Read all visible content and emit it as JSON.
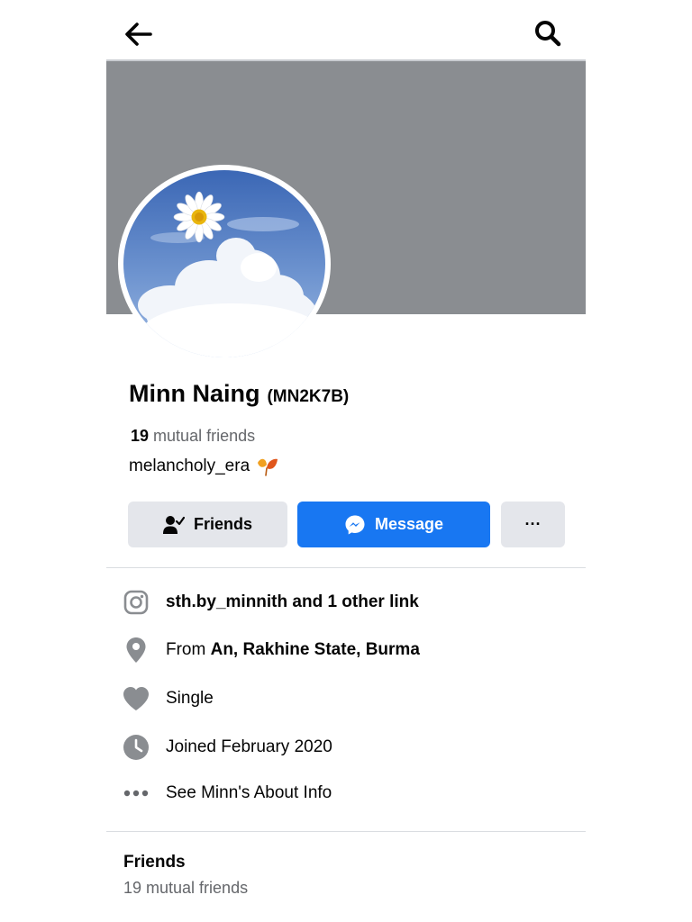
{
  "profile": {
    "name": "Minn Naing",
    "nickname": "(MN2K7B)",
    "mutual_count": "19",
    "mutual_label": "mutual friends",
    "bio": "melancholy_era"
  },
  "actions": {
    "friends_label": "Friends",
    "message_label": "Message",
    "more_label": "···"
  },
  "info": {
    "links": "sth.by_minnith and 1 other link",
    "from_prefix": "From",
    "from_place": "An, Rakhine State, Burma",
    "relationship": "Single",
    "joined": "Joined February 2020",
    "about": "See Minn's About Info"
  },
  "friends_section": {
    "title": "Friends",
    "subtitle": "19 mutual friends"
  },
  "icons": {
    "back": "back-arrow-icon",
    "search": "search-icon",
    "friends": "friends-check-icon",
    "messenger": "messenger-icon",
    "more": "more-dots-icon",
    "instagram": "instagram-icon",
    "location": "location-pin-icon",
    "heart": "heart-icon",
    "clock": "clock-icon",
    "about": "more-dots-icon",
    "bio_emoji": "fallen-leaf-icon"
  },
  "colors": {
    "brand_blue": "#1877f2",
    "cover_gray": "#8a8d91",
    "button_gray": "#e4e6eb",
    "secondary_text": "#65676b",
    "icon_gray": "#8a8d91"
  }
}
